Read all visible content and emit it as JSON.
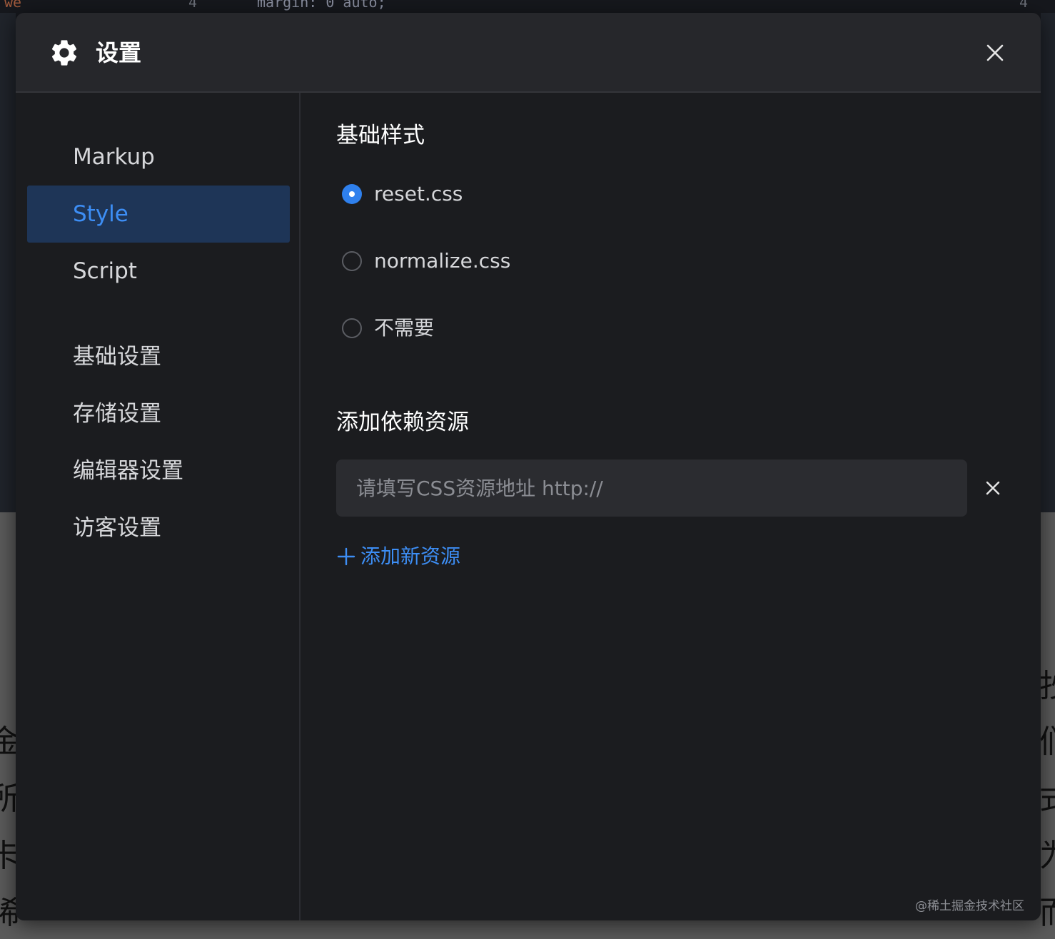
{
  "background": {
    "editor_snippet": "margin: 0 auto;",
    "editor_left_fragment": "we",
    "line_number": "4",
    "line_number_right": "4",
    "article_fragments": [
      "金",
      "所",
      "卡",
      "稀",
      "抄",
      "们",
      "式,",
      "为",
      "而"
    ]
  },
  "modal": {
    "title": "设置",
    "close_icon": "close-icon",
    "header_icon": "gear-icon"
  },
  "sidebar": {
    "items": [
      {
        "label": "Markup",
        "active": false
      },
      {
        "label": "Style",
        "active": true
      },
      {
        "label": "Script",
        "active": false
      },
      {
        "label": "基础设置",
        "active": false
      },
      {
        "label": "存储设置",
        "active": false
      },
      {
        "label": "编辑器设置",
        "active": false
      },
      {
        "label": "访客设置",
        "active": false
      }
    ]
  },
  "content": {
    "base_style": {
      "title": "基础样式",
      "options": [
        {
          "label": "reset.css",
          "checked": true
        },
        {
          "label": "normalize.css",
          "checked": false
        },
        {
          "label": "不需要",
          "checked": false
        }
      ]
    },
    "dependencies": {
      "title": "添加依赖资源",
      "input_value": "",
      "input_placeholder": "请填写CSS资源地址 http://",
      "add_label": "添加新资源"
    }
  },
  "colors": {
    "accent": "#3d8ef5",
    "active_bg": "#1e3557",
    "modal_bg": "#1b1c1f",
    "header_bg": "#26272b"
  },
  "watermark": "@稀土掘金技术社区"
}
